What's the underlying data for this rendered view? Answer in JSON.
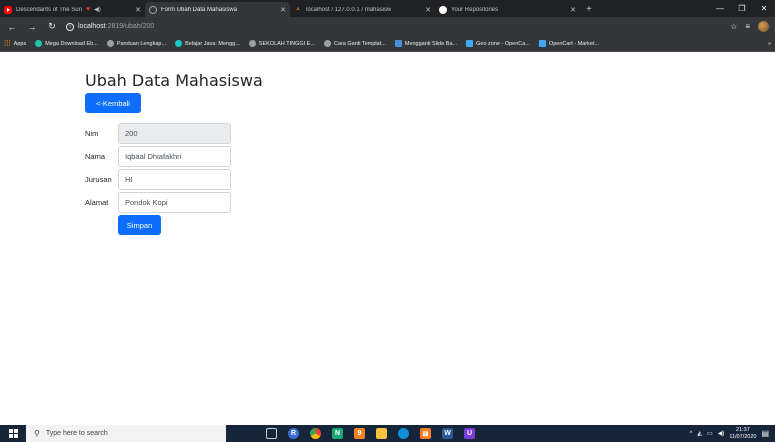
{
  "browser": {
    "tabs": [
      {
        "title": "Descendants of The Sun",
        "favicon": "youtube-icon",
        "color": "#ff0000",
        "active": false
      },
      {
        "title": "Form Ubah Data Mahasiswa",
        "favicon": "loading-icon",
        "color": "#9aa0a6",
        "active": true
      },
      {
        "title": "localhost / 127.0.0.1 / mahasisw",
        "favicon": "phpmyadmin-icon",
        "color": "#f29111",
        "active": false
      },
      {
        "title": "Your Repositories",
        "favicon": "github-icon",
        "color": "#ffffff",
        "active": false
      }
    ],
    "new_tab": "+",
    "url_host": "localhost",
    "url_path": ":2819/ubah/200",
    "bookmarks": [
      {
        "label": "Apps",
        "color": "#f29111"
      },
      {
        "label": "Mega Download Eb...",
        "color": "#1ec7a6"
      },
      {
        "label": "Panduan Lengkap...",
        "color": "#9aa0a6"
      },
      {
        "label": "Belajar Java: Mengg...",
        "color": "#1ec7c7"
      },
      {
        "label": "SEKOLAH TINGGI E...",
        "color": "#9aa0a6"
      },
      {
        "label": "Cara Ganti Templat...",
        "color": "#9aa0a6"
      },
      {
        "label": "Mengganti Slide Ba...",
        "color": "#4a90d9"
      },
      {
        "label": "Geo zone - OpenCa...",
        "color": "#3fa9f5"
      },
      {
        "label": "OpenCart - Market...",
        "color": "#3fa9f5"
      }
    ],
    "more": "»"
  },
  "page": {
    "title": "Ubah Data Mahasiswa",
    "back_label": "<-Kembali",
    "fields": [
      {
        "label": "Nim",
        "value": "200",
        "disabled": true
      },
      {
        "label": "Nama",
        "value": "Iqbaal Dhiafakhri",
        "disabled": false
      },
      {
        "label": "Jurusan",
        "value": "HI",
        "disabled": false
      },
      {
        "label": "Alamat",
        "value": "Pondok Kopi",
        "disabled": false
      }
    ],
    "save_label": "Simpan"
  },
  "taskbar": {
    "search_placeholder": "Type here to search",
    "time": "21:37",
    "date": "11/07/2020"
  },
  "colors": {
    "primary": "#0d6efd",
    "chrome_dark": "#35363a",
    "taskbar": "#17253a"
  }
}
